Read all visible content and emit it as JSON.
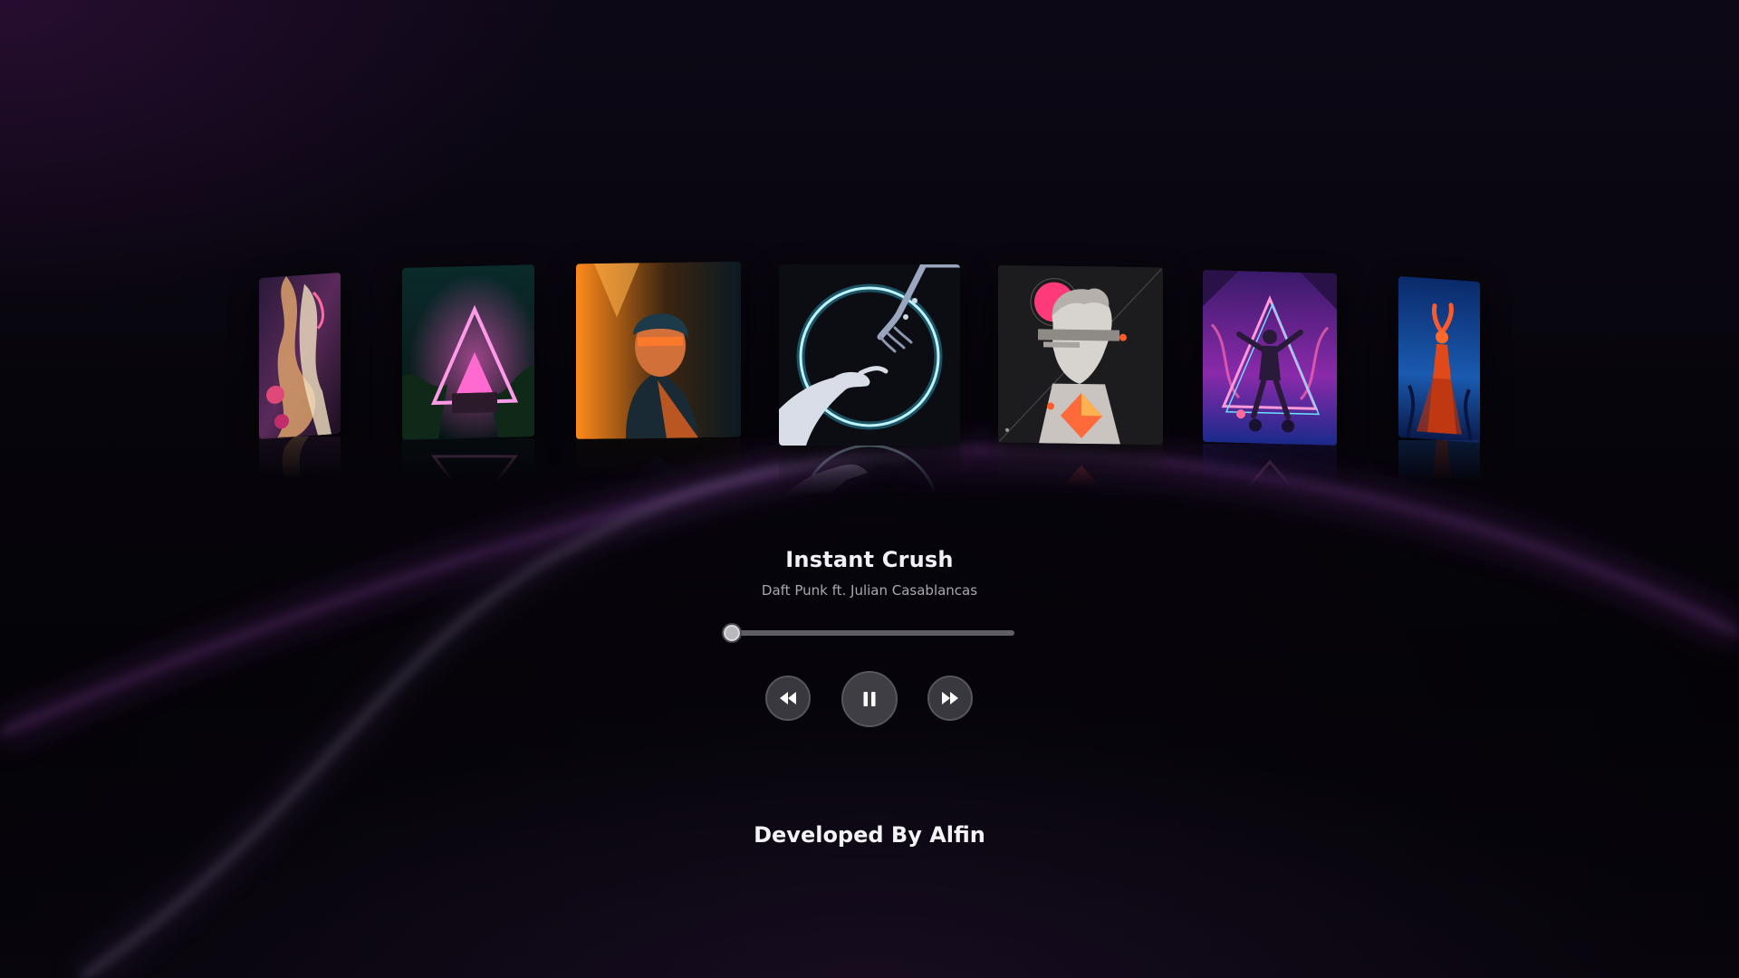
{
  "player": {
    "title": "Instant Crush",
    "artist": "Daft Punk ft. Julian Casablancas",
    "progress": 0.0,
    "state": "playing"
  },
  "controls": {
    "previous_icon": "rewind-icon",
    "play_pause_icon": "pause-icon",
    "next_icon": "fast-forward-icon"
  },
  "covers": [
    {
      "name": "album-cover-abstract-liquid",
      "active": false
    },
    {
      "name": "album-cover-neon-triangle-forest",
      "active": false
    },
    {
      "name": "album-cover-orange-light-portrait",
      "active": false
    },
    {
      "name": "album-cover-neon-circle-hands",
      "active": true
    },
    {
      "name": "album-cover-glitch-statue",
      "active": false
    },
    {
      "name": "album-cover-neon-triangle-dancer",
      "active": false
    },
    {
      "name": "album-cover-blue-dancer",
      "active": false
    }
  ],
  "footer": {
    "credit": "Developed By Alfin"
  },
  "colors": {
    "background": "#050309",
    "accent_glow": "#8a3fae",
    "control_bg": "#3a383f",
    "text_primary": "#f2f2f5",
    "text_secondary": "#a9a7b0"
  }
}
